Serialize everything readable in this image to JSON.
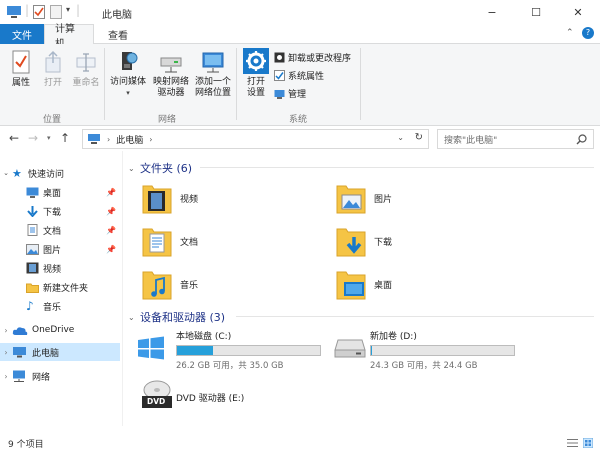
{
  "titlebar": {
    "title": "此电脑",
    "min": "−",
    "max": "☐",
    "close": "✕"
  },
  "tabs": {
    "file": "文件",
    "computer": "计算机",
    "view": "查看"
  },
  "ribbon": {
    "location": {
      "properties": "属性",
      "open": "打开",
      "rename": "重命名",
      "group": "位置"
    },
    "network": {
      "media": "访问媒体",
      "map_drive_1": "映射网络",
      "map_drive_2": "驱动器",
      "add_loc_1": "添加一个",
      "add_loc_2": "网络位置",
      "group": "网络"
    },
    "system": {
      "settings_1": "打开",
      "settings_2": "设置",
      "uninstall": "卸载或更改程序",
      "sysprops": "系统属性",
      "manage": "管理",
      "group": "系统"
    }
  },
  "address": {
    "path": "此电脑",
    "search_placeholder": "搜索\"此电脑\""
  },
  "sidebar": {
    "quick_access": "快速访问",
    "items": [
      "桌面",
      "下载",
      "文档",
      "图片",
      "视频",
      "新建文件夹",
      "音乐"
    ],
    "onedrive": "OneDrive",
    "thispc": "此电脑",
    "network": "网络"
  },
  "folders": {
    "header": "文件夹 (6)",
    "items": [
      "视频",
      "图片",
      "文档",
      "下载",
      "音乐",
      "桌面"
    ]
  },
  "drives": {
    "header": "设备和驱动器 (3)",
    "c": {
      "name": "本地磁盘 (C:)",
      "info": "26.2 GB 可用，共 35.0 GB",
      "used_fraction": 0.25
    },
    "d": {
      "name": "新加卷 (D:)",
      "info": "24.3 GB 可用，共 24.4 GB",
      "used_fraction": 0.004
    },
    "e": {
      "name": "DVD 驱动器 (E:)",
      "badge": "DVD"
    }
  },
  "status": {
    "count": "9 个项目"
  },
  "colors": {
    "accent": "#1979ca",
    "folder": "#f5c445",
    "selection": "#cce8ff",
    "drive_fill": "#26a0da",
    "section_text": "#1e3287"
  }
}
